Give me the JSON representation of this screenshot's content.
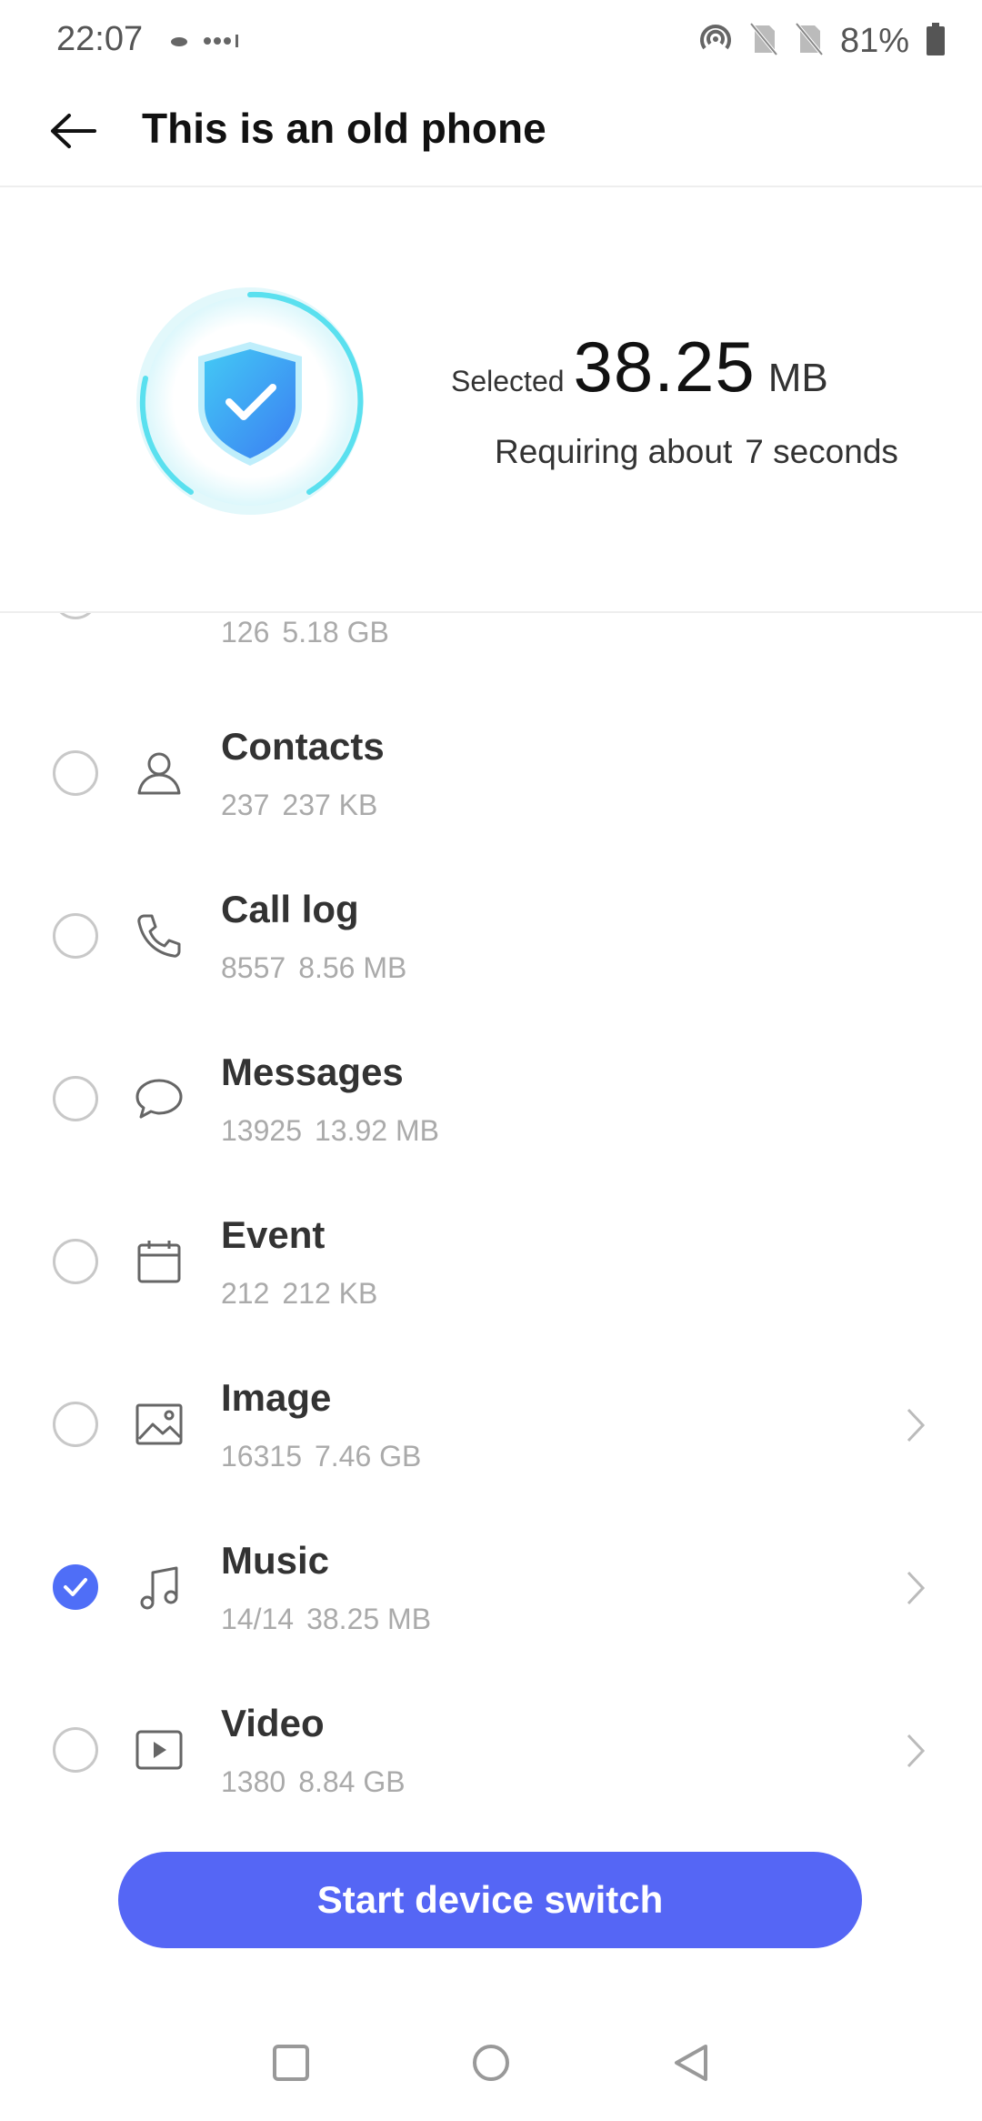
{
  "status_bar": {
    "time": "22:07",
    "battery_percent": "81%",
    "icons": [
      "cloud-icon",
      "more-dots-icon",
      "hotspot-icon",
      "no-sim-icon",
      "no-sim-icon",
      "battery-icon"
    ]
  },
  "header": {
    "back_icon": "arrow-left-icon",
    "title": "This is an old phone"
  },
  "summary": {
    "selected_label": "Selected",
    "selected_value": "38.25",
    "selected_unit": "MB",
    "requiring_label": "Requiring about",
    "requiring_value": "7 seconds"
  },
  "items": [
    {
      "title": "",
      "count": "126",
      "size": "5.18 GB",
      "checked": false,
      "icon": "apps-icon",
      "has_chevron": true
    },
    {
      "title": "Contacts",
      "count": "237",
      "size": "237 KB",
      "checked": false,
      "icon": "person-icon",
      "has_chevron": false
    },
    {
      "title": "Call log",
      "count": "8557",
      "size": "8.56 MB",
      "checked": false,
      "icon": "phone-icon",
      "has_chevron": false
    },
    {
      "title": "Messages",
      "count": "13925",
      "size": "13.92 MB",
      "checked": false,
      "icon": "chat-bubble-icon",
      "has_chevron": false
    },
    {
      "title": "Event",
      "count": "212",
      "size": "212 KB",
      "checked": false,
      "icon": "calendar-icon",
      "has_chevron": false
    },
    {
      "title": "Image",
      "count": "16315",
      "size": "7.46 GB",
      "checked": false,
      "icon": "image-icon",
      "has_chevron": true
    },
    {
      "title": "Music",
      "count": "14/14",
      "size": "38.25 MB",
      "checked": true,
      "icon": "music-note-icon",
      "has_chevron": true
    },
    {
      "title": "Video",
      "count": "1380",
      "size": "8.84 GB",
      "checked": false,
      "icon": "video-play-icon",
      "has_chevron": true
    }
  ],
  "actions": {
    "start_label": "Start device switch"
  },
  "colors": {
    "accent": "#5566f5",
    "check": "#4f6ef7",
    "shield_start": "#43c9f5",
    "shield_end": "#3b7ef2",
    "ring": "#52dff0"
  },
  "nav": [
    "recents-square-icon",
    "home-circle-icon",
    "back-triangle-icon"
  ]
}
